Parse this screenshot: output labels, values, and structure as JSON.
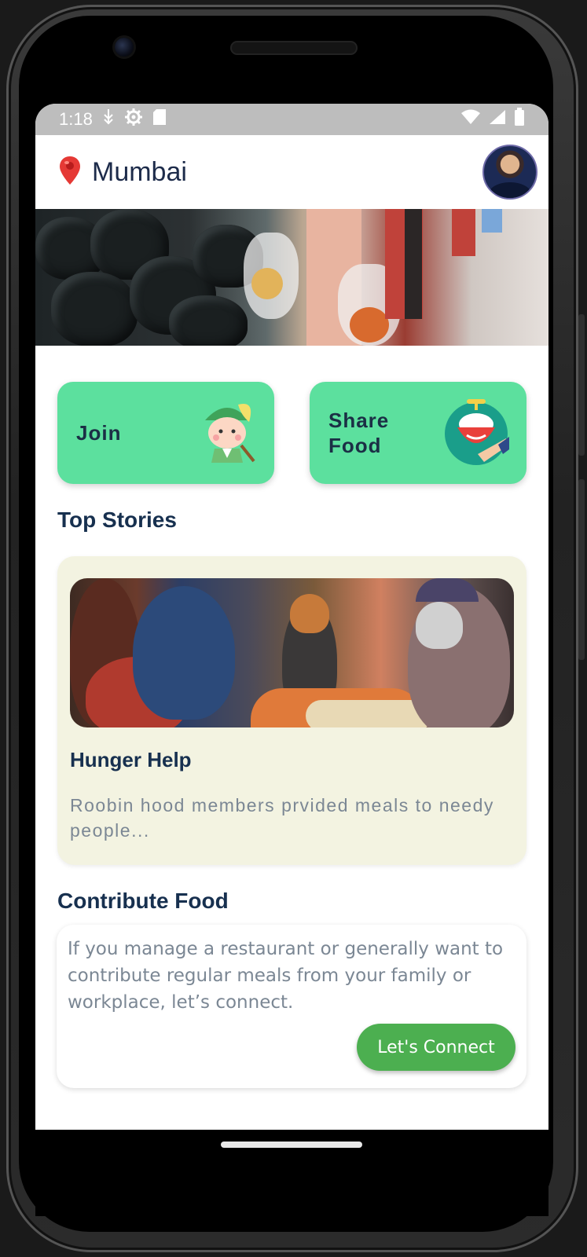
{
  "status_bar": {
    "time": "1:18"
  },
  "app_bar": {
    "location": "Mumbai"
  },
  "actions": [
    {
      "label": "Join"
    },
    {
      "label": "Share\nFood"
    }
  ],
  "top_stories": {
    "heading": "Top Stories",
    "story": {
      "title": "Hunger Help",
      "description": "Roobin hood members prvided meals to needy people..."
    }
  },
  "contribute": {
    "heading": "Contribute Food",
    "text": "If you manage a restaurant or generally want to contribute regular meals from your family or workplace, let’s connect.",
    "button_label": "Let's Connect"
  },
  "colors": {
    "accent_green": "#5ce09e",
    "button_green": "#4caf50",
    "story_bg": "#f3f3e1",
    "title_navy": "#17304f"
  }
}
